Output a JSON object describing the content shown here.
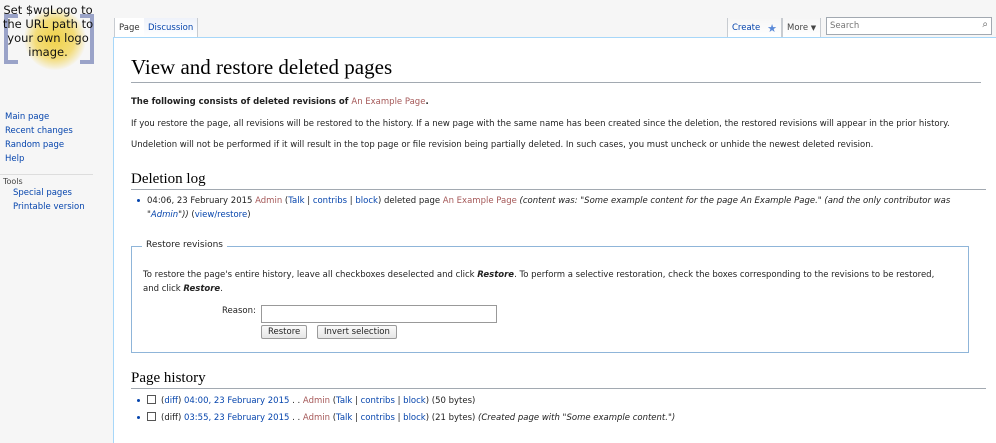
{
  "logo": {
    "text": "Set $wgLogo to the URL path to your own logo image."
  },
  "sidebar": {
    "nav": [
      "Main page",
      "Recent changes",
      "Random page",
      "Help"
    ],
    "tools_heading": "Tools",
    "tools": [
      "Special pages",
      "Printable version"
    ]
  },
  "tabs": {
    "page": "Page",
    "discussion": "Discussion",
    "create": "Create",
    "more": "More"
  },
  "search": {
    "placeholder": "Search"
  },
  "page": {
    "title": "View and restore deleted pages",
    "intro_prefix": "The following consists of deleted revisions of ",
    "intro_link": "An Example Page",
    "intro_suffix": ".",
    "para1": "If you restore the page, all revisions will be restored to the history. If a new page with the same name has been created since the deletion, the restored revisions will appear in the prior history.",
    "para2": "Undeletion will not be performed if it will result in the top page or file revision being partially deleted. In such cases, you must uncheck or unhide the newest deleted revision."
  },
  "deletion_log": {
    "heading": "Deletion log",
    "entry": {
      "timestamp": "04:06, 23 February 2015",
      "user": "Admin",
      "talk": "Talk",
      "contribs": "contribs",
      "block": "block",
      "action": "deleted page",
      "page": "An Example Page",
      "comment_start": "(content was: \"Some example content for the page An Example Page.\" (and the only contributor was \"",
      "comment_user": "Admin",
      "comment_end": "\"))",
      "view_restore": "view/restore"
    }
  },
  "restore": {
    "legend": "Restore revisions",
    "instr_1": "To restore the page's entire history, leave all checkboxes deselected and click ",
    "instr_restore": "Restore",
    "instr_2": ". To perform a selective restoration, check the boxes corresponding to the revisions to be restored,",
    "instr_3": "and click ",
    "instr_restore2": "Restore",
    "instr_4": ".",
    "reason_label": "Reason:",
    "reason_value": "",
    "restore_button": "Restore",
    "invert_button": "Invert selection"
  },
  "history": {
    "heading": "Page history",
    "rows": [
      {
        "diff": "diff",
        "time": "04:00, 23 February 2015",
        "user": "Admin",
        "talk": "Talk",
        "contribs": "contribs",
        "block": "block",
        "size": "(50 bytes)",
        "comment": ""
      },
      {
        "diff": "diff",
        "time": "03:55, 23 February 2015",
        "user": "Admin",
        "talk": "Talk",
        "contribs": "contribs",
        "block": "block",
        "size": "(21 bytes)",
        "comment": "(Created page with \"Some example content.\")"
      }
    ]
  },
  "colors": {
    "link": "#0645ad",
    "redlink": "#a55858",
    "border": "#a7d7f9"
  }
}
